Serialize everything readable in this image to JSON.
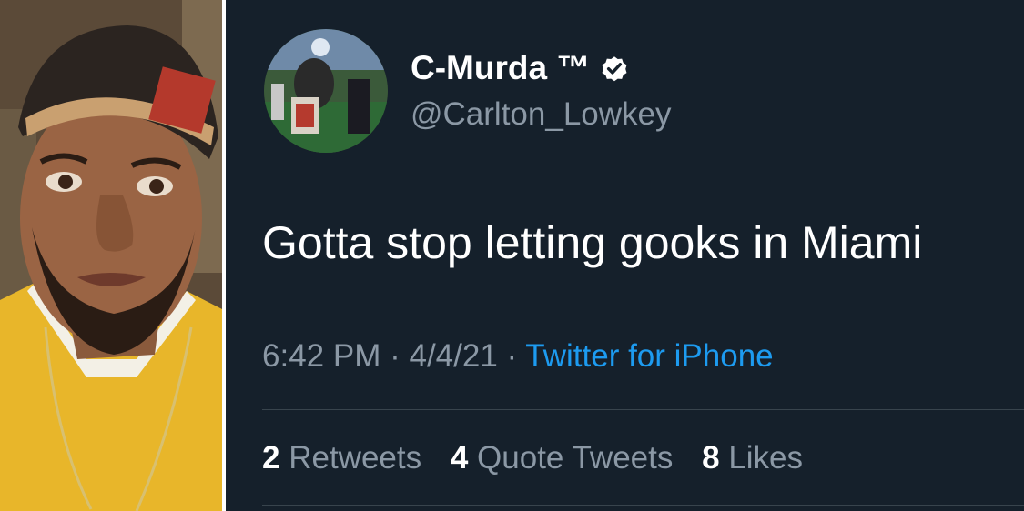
{
  "profile": {
    "display_name": "C-Murda ™",
    "handle": "@Carlton_Lowkey",
    "verified_icon": "verified-badge-icon"
  },
  "tweet": {
    "text": "Gotta stop letting gooks in Miami",
    "time": "6:42 PM",
    "separator": "·",
    "date": "4/4/21",
    "source": "Twitter for iPhone"
  },
  "stats": {
    "retweets_count": "2",
    "retweets_label": "Retweets",
    "quote_count": "4",
    "quote_label": "Quote Tweets",
    "likes_count": "8",
    "likes_label": "Likes"
  },
  "colors": {
    "background": "#15202b",
    "text_primary": "#ffffff",
    "text_secondary": "#8b98a5",
    "link": "#1d9bf0",
    "divider": "#38444d"
  }
}
